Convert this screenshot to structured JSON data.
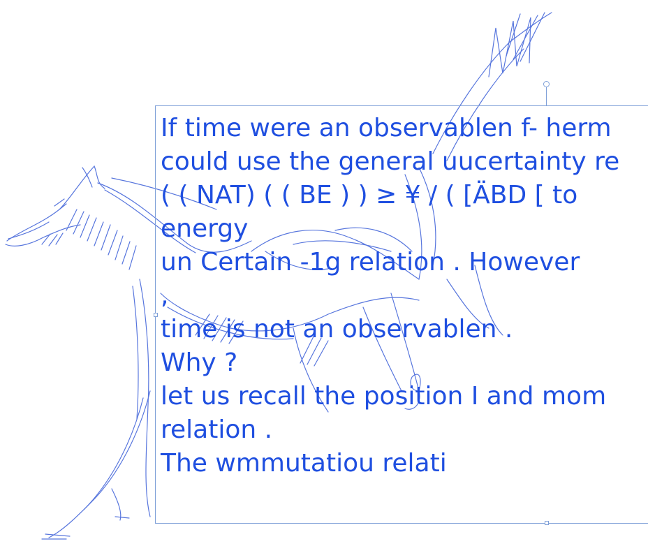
{
  "text_box": {
    "lines": [
      "If time were an observablen f- herm",
      "could use the general uucertainty re",
      "( ( NAT) ( ( BE ) ) ≥ ¥ / ( [ÄBD [ to",
      "energy",
      "un Certain -1g relation . However",
      ",",
      "time is not an observablen .",
      "Why ?",
      "let us recall the position I and mom",
      "relation .",
      "The wmmutatiou relati"
    ]
  },
  "colors": {
    "ink": "#1f4fe0",
    "sketch": "#3b5fd8",
    "selection": "#7fa0d8",
    "background": "#ffffff"
  }
}
